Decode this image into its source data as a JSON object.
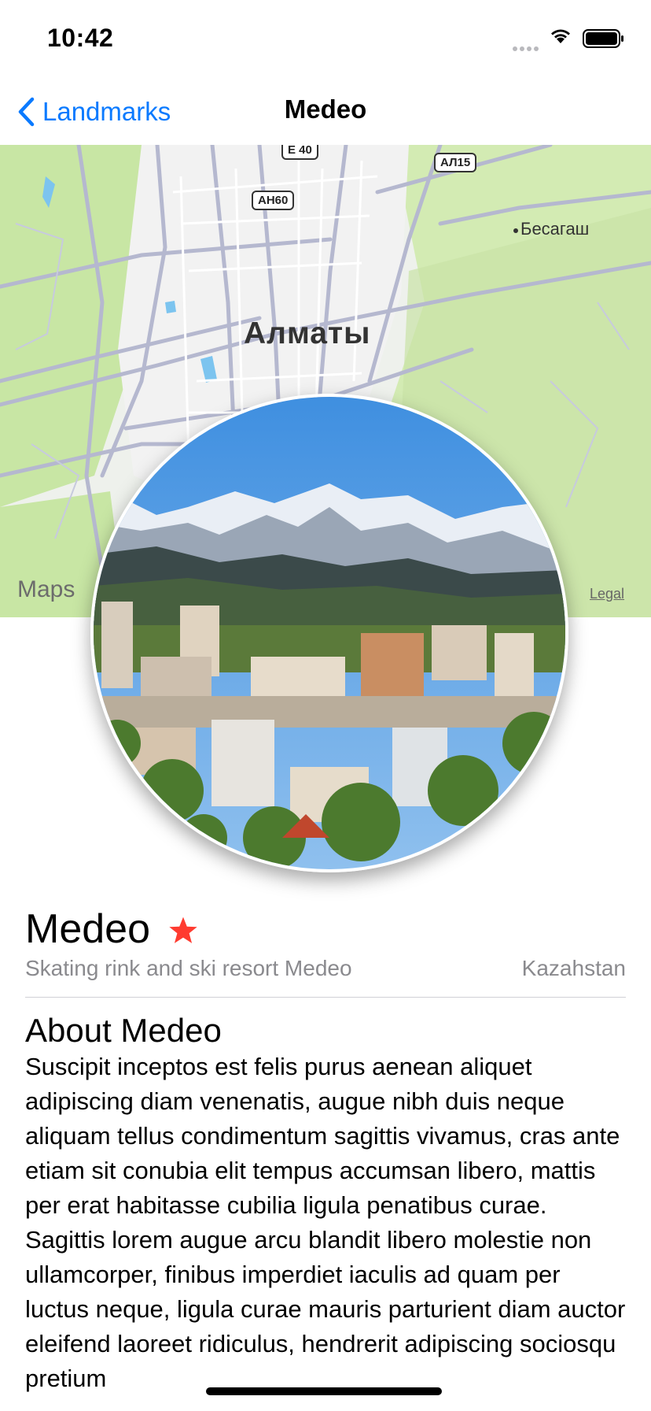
{
  "status_bar": {
    "time": "10:42"
  },
  "nav": {
    "back_label": "Landmarks",
    "title": "Medeo"
  },
  "map": {
    "city_label": "Алматы",
    "village_label": "Бесагаш",
    "shields": [
      "E 40",
      "АЛ15",
      "AH60"
    ],
    "maps_logo": "Maps",
    "legal_label": "Legal"
  },
  "landmark": {
    "name": "Medeo",
    "is_favorite": true,
    "park": "Skating rink and ski resort Medeo",
    "state": "Kazahstan",
    "about_heading": "About Medeo",
    "description": "Suscipit inceptos est felis purus aenean aliquet adipiscing diam venenatis, augue nibh duis neque aliquam tellus condimentum sagittis vivamus, cras ante etiam sit conubia elit tempus accumsan libero, mattis per erat habitasse cubilia ligula penatibus curae. Sagittis lorem augue arcu blandit libero molestie non ullamcorper, finibus imperdiet iaculis ad quam per luctus neque, ligula curae mauris parturient diam auctor eleifend laoreet ridiculus, hendrerit adipiscing sociosqu pretium"
  },
  "colors": {
    "accent": "#0a7aff",
    "star": "#ff3b30",
    "secondary_text": "#8a8a8e"
  }
}
